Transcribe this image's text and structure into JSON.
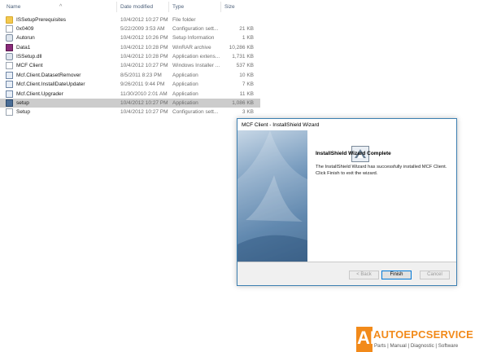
{
  "explorer": {
    "columns": {
      "name": "Name",
      "date": "Date modified",
      "type": "Type",
      "size": "Size"
    },
    "rows": [
      {
        "name": "ISSetupPrerequisites",
        "date": "10/4/2012 10:27 PM",
        "type": "File folder",
        "size": "",
        "icon": "folder"
      },
      {
        "name": "0x0409",
        "date": "5/22/2009 3:53 AM",
        "type": "Configuration sett...",
        "size": "21 KB",
        "icon": "doc"
      },
      {
        "name": "Autorun",
        "date": "10/4/2012 10:26 PM",
        "type": "Setup Information",
        "size": "1 KB",
        "icon": "gear"
      },
      {
        "name": "Data1",
        "date": "10/4/2012 10:28 PM",
        "type": "WinRAR archive",
        "size": "10,286 KB",
        "icon": "rar"
      },
      {
        "name": "ISSetup.dll",
        "date": "10/4/2012 10:28 PM",
        "type": "Application extens...",
        "size": "1,731 KB",
        "icon": "gear"
      },
      {
        "name": "MCF Client",
        "date": "10/4/2012 10:27 PM",
        "type": "Windows Installer ...",
        "size": "537 KB",
        "icon": "doc"
      },
      {
        "name": "Mcf.Client.DatasetRemover",
        "date": "8/5/2011 8:23 PM",
        "type": "Application",
        "size": "10 KB",
        "icon": "app"
      },
      {
        "name": "Mcf.Client.InstallDateUpdater",
        "date": "9/26/2011 9:44 PM",
        "type": "Application",
        "size": "7 KB",
        "icon": "app"
      },
      {
        "name": "Mcf.Client.Upgrader",
        "date": "11/30/2010 2:01 AM",
        "type": "Application",
        "size": "11 KB",
        "icon": "app"
      },
      {
        "name": "setup",
        "date": "10/4/2012 10:27 PM",
        "type": "Application",
        "size": "1,086 KB",
        "icon": "setup",
        "selected": true
      },
      {
        "name": "Setup",
        "date": "10/4/2012 10:27 PM",
        "type": "Configuration sett...",
        "size": "3 KB",
        "icon": "doc"
      }
    ]
  },
  "wizard": {
    "title": "MCF Client - InstallShield Wizard",
    "heading": "InstallShield Wizard Complete",
    "message": "The InstallShield Wizard has successfully installed MCF Client. Click Finish to exit the wizard.",
    "buttons": {
      "back": "< Back",
      "finish": "Finish",
      "cancel": "Cancel"
    }
  },
  "brand": {
    "mark": "AE",
    "name": "AUTOEPCSERVICE",
    "tagline": "Parts | Manual | Diagnostic | Software",
    "color": "#f28a1a"
  }
}
